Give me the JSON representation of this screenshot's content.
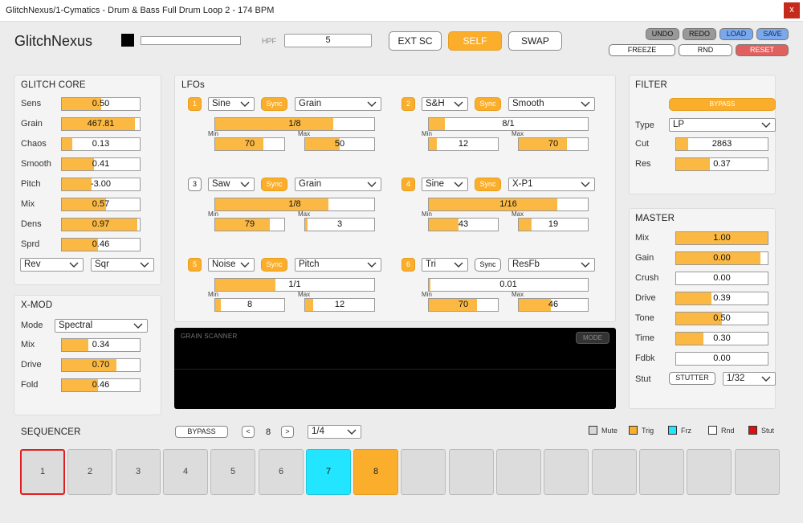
{
  "window": {
    "title": "GlitchNexus/1-Cymatics - Drum & Bass Full Drum Loop 2 - 174 BPM",
    "close": "x"
  },
  "header": {
    "brand": "GlitchNexus",
    "hpf_label": "HPF",
    "hpf_value": "5",
    "ext_sc": "EXT SC",
    "self": "SELF",
    "swap": "SWAP",
    "undo": "UNDO",
    "redo": "REDO",
    "load": "LOAD",
    "save": "SAVE",
    "freeze": "FREEZE",
    "rnd": "RND",
    "reset": "RESET"
  },
  "glitch_core": {
    "title": "GLITCH CORE",
    "params": [
      {
        "label": "Sens",
        "value": "0.50",
        "fraction": 0.5
      },
      {
        "label": "Grain",
        "value": "467.81",
        "fraction": 0.94
      },
      {
        "label": "Chaos",
        "value": "0.13",
        "fraction": 0.13
      },
      {
        "label": "Smooth",
        "value": "0.41",
        "fraction": 0.41
      },
      {
        "label": "Pitch",
        "value": "-3.00",
        "fraction": 0.38
      },
      {
        "label": "Mix",
        "value": "0.57",
        "fraction": 0.57
      },
      {
        "label": "Dens",
        "value": "0.97",
        "fraction": 0.97
      },
      {
        "label": "Sprd",
        "value": "0.46",
        "fraction": 0.46
      }
    ],
    "dd1": "Rev",
    "dd2": "Sqr"
  },
  "xmod": {
    "title": "X-MOD",
    "mode_label": "Mode",
    "mode_value": "Spectral",
    "params": [
      {
        "label": "Mix",
        "value": "0.34",
        "fraction": 0.34
      },
      {
        "label": "Drive",
        "value": "0.70",
        "fraction": 0.7
      },
      {
        "label": "Fold",
        "value": "0.46",
        "fraction": 0.46
      }
    ]
  },
  "lfos": {
    "title": "LFOs",
    "min_label": "Min",
    "max_label": "Max",
    "items": [
      {
        "num": "1",
        "active": true,
        "wave": "Sine",
        "sync": "Sync",
        "sync_on": true,
        "target": "Grain",
        "rate": "1/8",
        "rate_fraction": 0.74,
        "min": "70",
        "min_fraction": 0.7,
        "max": "50",
        "max_fraction": 0.5
      },
      {
        "num": "2",
        "active": true,
        "wave": "S&H",
        "sync": "Sync",
        "sync_on": true,
        "target": "Smooth",
        "rate": "8/1",
        "rate_fraction": 0.1,
        "min": "12",
        "min_fraction": 0.12,
        "max": "70",
        "max_fraction": 0.7
      },
      {
        "num": "3",
        "active": false,
        "wave": "Saw",
        "sync": "Sync",
        "sync_on": true,
        "target": "Grain",
        "rate": "1/8",
        "rate_fraction": 0.71,
        "min": "79",
        "min_fraction": 0.79,
        "max": "3",
        "max_fraction": 0.03
      },
      {
        "num": "4",
        "active": true,
        "wave": "Sine",
        "sync": "Sync",
        "sync_on": true,
        "target": "X-P1",
        "rate": "1/16",
        "rate_fraction": 0.81,
        "min": "43",
        "min_fraction": 0.43,
        "max": "19",
        "max_fraction": 0.19
      },
      {
        "num": "5",
        "active": true,
        "wave": "Noise",
        "sync": "Sync",
        "sync_on": true,
        "target": "Pitch",
        "rate": "1/1",
        "rate_fraction": 0.38,
        "min": "8",
        "min_fraction": 0.08,
        "max": "12",
        "max_fraction": 0.12
      },
      {
        "num": "6",
        "active": true,
        "wave": "Tri",
        "sync": "Sync",
        "sync_on": false,
        "target": "ResFb",
        "rate": "0.01",
        "rate_fraction": 0.01,
        "min": "70",
        "min_fraction": 0.7,
        "max": "46",
        "max_fraction": 0.46
      }
    ]
  },
  "scanner": {
    "title": "GRAIN SCANNER",
    "mode": "MODE"
  },
  "filter": {
    "title": "FILTER",
    "bypass": "BYPASS",
    "type_label": "Type",
    "type_value": "LP",
    "params": [
      {
        "label": "Cut",
        "value": "2863",
        "fraction": 0.13
      },
      {
        "label": "Res",
        "value": "0.37",
        "fraction": 0.37
      }
    ]
  },
  "master": {
    "title": "MASTER",
    "params": [
      {
        "label": "Mix",
        "value": "1.00",
        "fraction": 1.0
      },
      {
        "label": "Gain",
        "value": "0.00",
        "fraction": 0.92
      },
      {
        "label": "Crush",
        "value": "0.00",
        "fraction": 0.0
      },
      {
        "label": "Drive",
        "value": "0.39",
        "fraction": 0.39
      },
      {
        "label": "Tone",
        "value": "0.50",
        "fraction": 0.5
      },
      {
        "label": "Time",
        "value": "0.30",
        "fraction": 0.3
      },
      {
        "label": "Fdbk",
        "value": "0.00",
        "fraction": 0.0
      }
    ],
    "stut_label": "Stut",
    "stutter": "STUTTER",
    "stut_div": "1/32"
  },
  "sequencer": {
    "title": "SEQUENCER",
    "bypass": "BYPASS",
    "prev": "<",
    "count": "8",
    "next": ">",
    "division": "1/4",
    "legend": [
      {
        "label": "Mute",
        "color": "#d8d8d8"
      },
      {
        "label": "Trig",
        "color": "#fbae2c"
      },
      {
        "label": "Frz",
        "color": "#22e6ff"
      },
      {
        "label": "Rnd",
        "color": "#ffffff"
      },
      {
        "label": "Stut",
        "color": "#e01010"
      }
    ],
    "steps": [
      {
        "label": "1",
        "state": "sel"
      },
      {
        "label": "2",
        "state": ""
      },
      {
        "label": "3",
        "state": ""
      },
      {
        "label": "4",
        "state": ""
      },
      {
        "label": "5",
        "state": ""
      },
      {
        "label": "6",
        "state": ""
      },
      {
        "label": "7",
        "state": "frz"
      },
      {
        "label": "8",
        "state": "trig"
      },
      {
        "label": "",
        "state": ""
      },
      {
        "label": "",
        "state": ""
      },
      {
        "label": "",
        "state": ""
      },
      {
        "label": "",
        "state": ""
      },
      {
        "label": "",
        "state": ""
      },
      {
        "label": "",
        "state": ""
      },
      {
        "label": "",
        "state": ""
      },
      {
        "label": "",
        "state": ""
      }
    ]
  }
}
